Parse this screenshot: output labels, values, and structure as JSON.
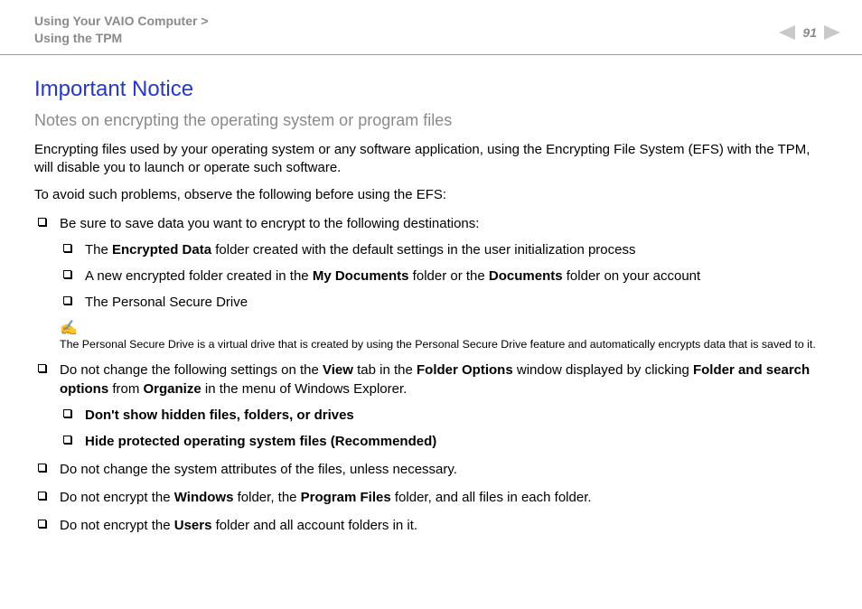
{
  "header": {
    "breadcrumb_top": "Using Your VAIO Computer",
    "breadcrumb_sep": ">",
    "breadcrumb_bottom": "Using the TPM",
    "page_number": "91"
  },
  "title": "Important Notice",
  "subtitle": "Notes on encrypting the operating system or program files",
  "para1": "Encrypting files used by your operating system or any software application, using the Encrypting File System (EFS) with the TPM, will disable you to launch or operate such software.",
  "para2": "To avoid such problems, observe the following before using the EFS:",
  "bullets": {
    "b1": "Be sure to save data you want to encrypt to the following destinations:",
    "b1_sub": {
      "s1_pre": "The ",
      "s1_bold": "Encrypted Data",
      "s1_post": " folder created with the default settings in the user initialization process",
      "s2_pre": "A new encrypted folder created in the ",
      "s2_b1": "My Documents",
      "s2_mid": " folder or the ",
      "s2_b2": "Documents",
      "s2_post": " folder on your account",
      "s3": "The Personal Secure Drive"
    },
    "note_icon": "✍",
    "note": "The Personal Secure Drive is a virtual drive that is created by using the Personal Secure Drive feature and automatically encrypts data that is saved to it.",
    "b2_pre": "Do not change the following settings on the ",
    "b2_b1": "View",
    "b2_m1": " tab in the ",
    "b2_b2": "Folder Options",
    "b2_m2": " window displayed by clicking ",
    "b2_b3": "Folder and search options",
    "b2_m3": " from ",
    "b2_b4": "Organize",
    "b2_post": " in the menu of Windows Explorer.",
    "b2_sub": {
      "s1": "Don't show hidden files, folders, or drives",
      "s2": "Hide protected operating system files (Recommended)"
    },
    "b3": "Do not change the system attributes of the files, unless necessary.",
    "b4_pre": "Do not encrypt the ",
    "b4_b1": "Windows",
    "b4_m1": " folder, the ",
    "b4_b2": "Program Files",
    "b4_post": " folder, and all files in each folder.",
    "b5_pre": "Do not encrypt the ",
    "b5_b1": "Users",
    "b5_post": " folder and all account folders in it."
  }
}
